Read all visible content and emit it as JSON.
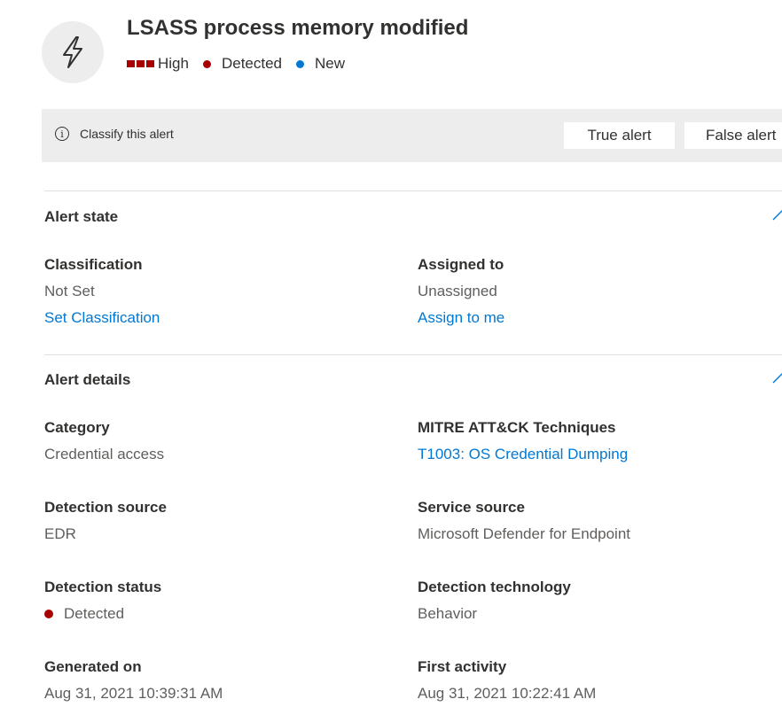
{
  "header": {
    "icon": "lightning-bolt-icon",
    "title": "LSASS process memory modified",
    "severity": "High",
    "status": "Detected",
    "state": "New"
  },
  "colors": {
    "severity_high": "#a80000",
    "detected_dot": "#a80000",
    "new_dot": "#0078d4",
    "link": "#0078d4",
    "classify_bar_bg": "#ededed"
  },
  "classify": {
    "label": "Classify this alert",
    "true_button": "True alert",
    "false_button": "False alert"
  },
  "alert_state": {
    "title": "Alert state",
    "classification_label": "Classification",
    "classification_value": "Not Set",
    "classification_link": "Set Classification",
    "assigned_label": "Assigned to",
    "assigned_value": "Unassigned",
    "assigned_link": "Assign to me"
  },
  "alert_details": {
    "title": "Alert details",
    "category_label": "Category",
    "category_value": "Credential access",
    "mitre_label": "MITRE ATT&CK Techniques",
    "mitre_link": "T1003: OS Credential Dumping",
    "detection_source_label": "Detection source",
    "detection_source_value": "EDR",
    "service_source_label": "Service source",
    "service_source_value": "Microsoft Defender for Endpoint",
    "detection_status_label": "Detection status",
    "detection_status_value": "Detected",
    "detection_technology_label": "Detection technology",
    "detection_technology_value": "Behavior",
    "generated_on_label": "Generated on",
    "generated_on_value": "Aug 31, 2021 10:39:31 AM",
    "first_activity_label": "First activity",
    "first_activity_value": "Aug 31, 2021 10:22:41 AM"
  }
}
